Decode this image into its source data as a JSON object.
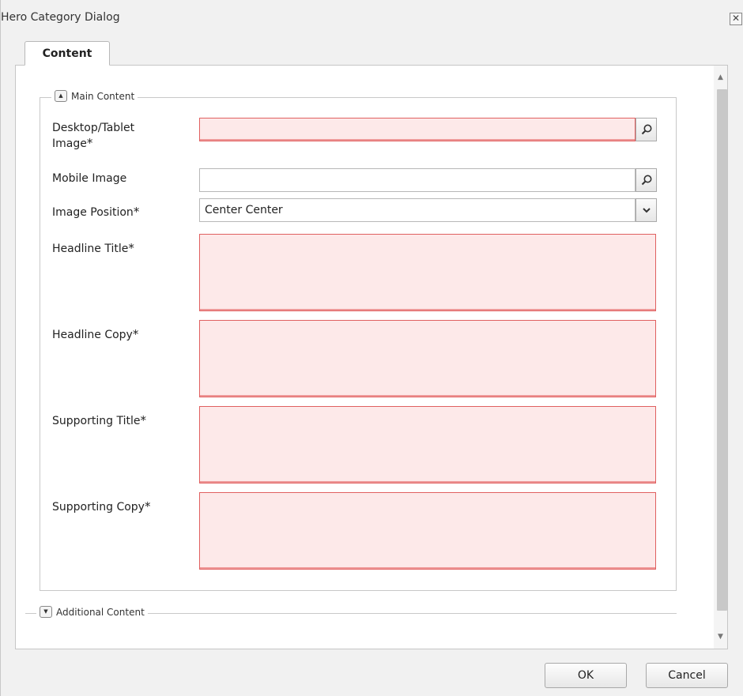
{
  "dialog": {
    "title": "Hero Category Dialog",
    "close_glyph": "✕"
  },
  "tabs": [
    {
      "label": "Content"
    }
  ],
  "main_section": {
    "legend": "Main Content",
    "toggle_glyph": "▲",
    "fields": {
      "desktop_image": {
        "label_line1": "Desktop/Tablet",
        "label_line2": "Image",
        "required_mark": "*",
        "value": ""
      },
      "mobile_image": {
        "label": "Mobile Image",
        "value": ""
      },
      "image_position": {
        "label": "Image Position",
        "required_mark": "*",
        "value": "Center Center"
      },
      "headline_title": {
        "label": "Headline Title",
        "required_mark": "*",
        "value": ""
      },
      "headline_copy": {
        "label": "Headline Copy",
        "required_mark": "*",
        "value": ""
      },
      "supporting_title": {
        "label": "Supporting Title",
        "required_mark": "*",
        "value": ""
      },
      "supporting_copy": {
        "label": "Supporting Copy",
        "required_mark": "*",
        "value": ""
      }
    }
  },
  "additional_section": {
    "legend": "Additional Content",
    "toggle_glyph": "▼"
  },
  "icons": {
    "search": "search-icon",
    "dropdown": "chevron-down-icon"
  },
  "colors": {
    "invalid_border": "#e06060",
    "invalid_fill": "#fde9e9"
  },
  "footer": {
    "ok_label": "OK",
    "cancel_label": "Cancel"
  }
}
